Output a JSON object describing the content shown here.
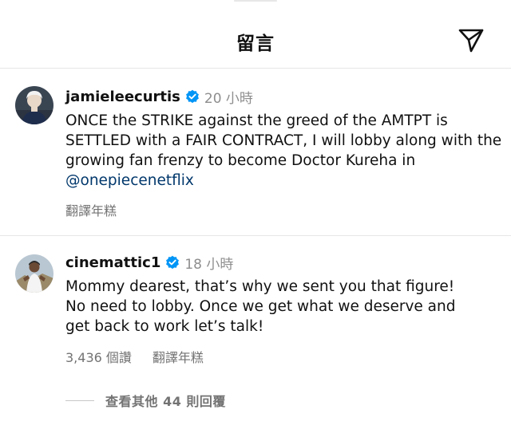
{
  "header": {
    "title": "留言",
    "share_icon": "paper-plane-icon"
  },
  "comments": [
    {
      "username": "jamieleecurtis",
      "verified": true,
      "time": "20 小時",
      "text_before": "ONCE the STRIKE against the greed of the AMTPT is SETTLED with a FAIR CONTRACT, I will lobby along with the growing fan frenzy to become Doctor Kureha in ",
      "mention": "@onepiecenetflix",
      "translate_label": "翻譯年糕"
    },
    {
      "username": "cinemattic1",
      "verified": true,
      "time": "18 小時",
      "text": "Mommy dearest, that’s why we sent you that figure! No need to lobby. Once we get what we deserve and get back to work let’s talk!",
      "likes_label": "3,436 個讚",
      "translate_label": "翻譯年糕"
    }
  ],
  "view_replies_label": "查看其他 44 則回覆",
  "colors": {
    "verified_badge": "#0095f6",
    "mention": "#00376b",
    "secondary_text": "#737373",
    "divider": "#e6e6e6"
  }
}
